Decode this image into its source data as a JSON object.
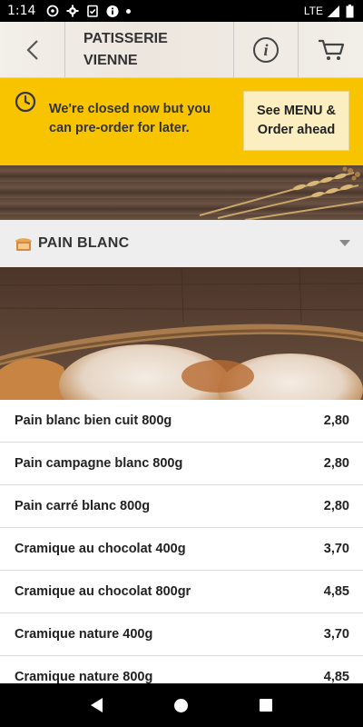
{
  "status_bar": {
    "time": "1:14",
    "network": "LTE"
  },
  "header": {
    "title_line1": "PATISSERIE",
    "title_line2": "VIENNE",
    "icons": [
      "back-arrow-icon",
      "info-icon",
      "cart-icon"
    ]
  },
  "banner": {
    "message": "We're closed now but you can pre-order for later.",
    "button_label_line1": "See MENU &",
    "button_label_line2": "Order ahead",
    "color": "#f8c400"
  },
  "section": {
    "title": "PAIN BLANC"
  },
  "products": [
    {
      "name": "Pain blanc bien cuit 800g",
      "price": "2,80"
    },
    {
      "name": "Pain campagne blanc 800g",
      "price": "2,80"
    },
    {
      "name": "Pain carré blanc 800g",
      "price": "2,80"
    },
    {
      "name": "Cramique au chocolat 400g",
      "price": "3,70"
    },
    {
      "name": "Cramique au chocolat 800gr",
      "price": "4,85"
    },
    {
      "name": "Cramique nature 400g",
      "price": "3,70"
    },
    {
      "name": "Cramique nature 800g",
      "price": "4,85"
    }
  ]
}
